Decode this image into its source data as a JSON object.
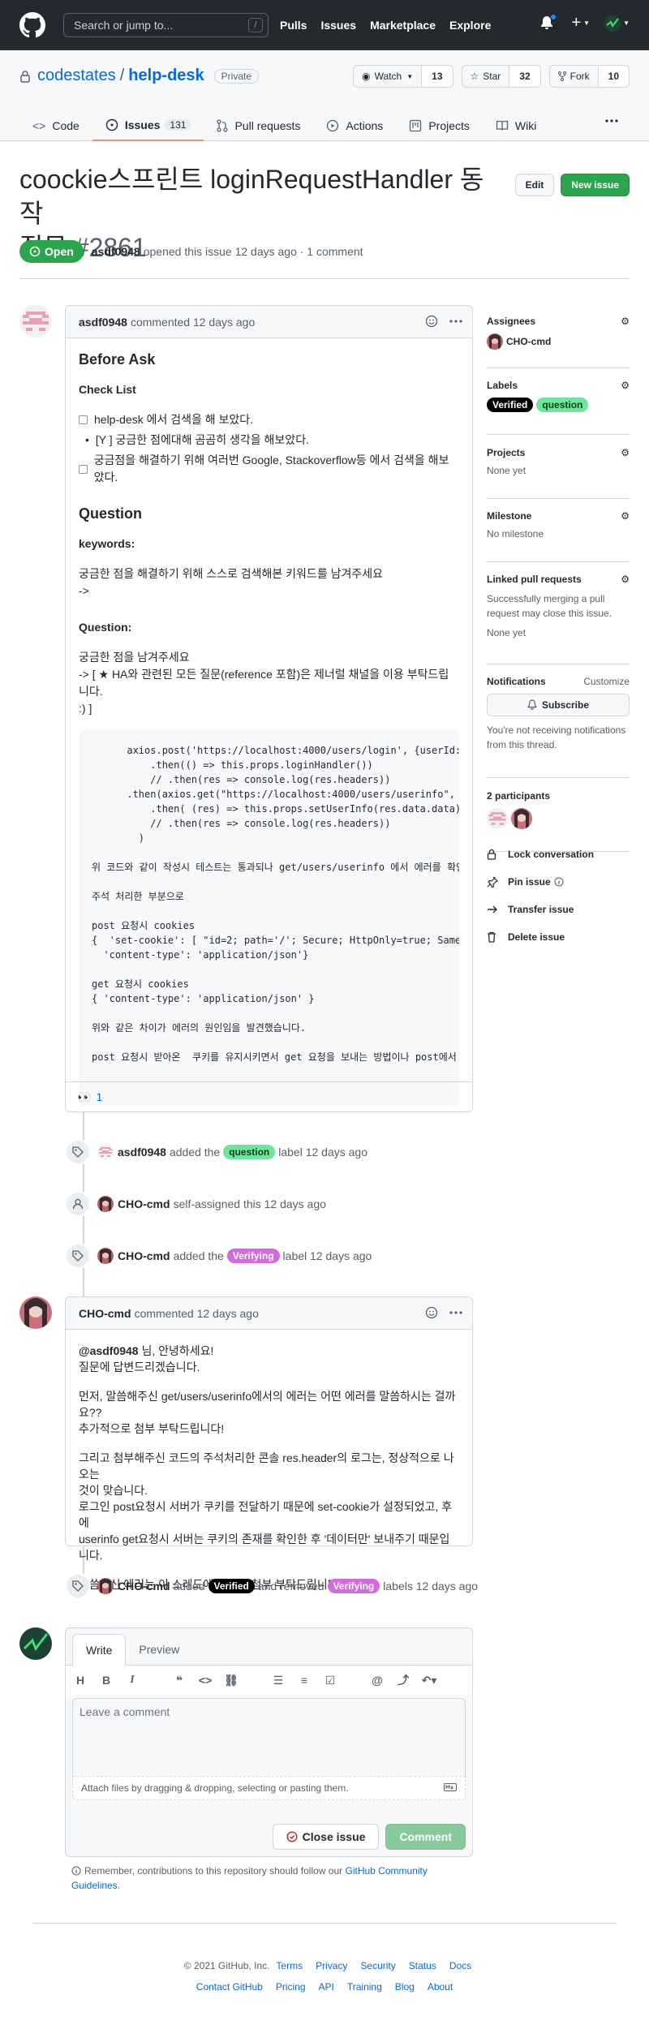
{
  "header": {
    "search_placeholder": "Search or jump to...",
    "search_shortcut": "/",
    "nav": [
      "Pulls",
      "Issues",
      "Marketplace",
      "Explore"
    ]
  },
  "repo": {
    "owner": "codestates",
    "separator": "/",
    "name": "help-desk",
    "visibility": "Private",
    "watch_label": "Watch",
    "watch_count": "13",
    "star_label": "Star",
    "star_count": "32",
    "fork_label": "Fork",
    "fork_count": "10",
    "tabs": [
      {
        "label": "Code",
        "icon": "code-icon"
      },
      {
        "label": "Issues",
        "icon": "issue-opened-icon",
        "count": "131"
      },
      {
        "label": "Pull requests",
        "icon": "git-pull-request-icon"
      },
      {
        "label": "Actions",
        "icon": "play-icon"
      },
      {
        "label": "Projects",
        "icon": "project-icon"
      },
      {
        "label": "Wiki",
        "icon": "book-icon"
      }
    ]
  },
  "issue": {
    "title_line1": "coockie스프린트 loginRequestHandler 동작",
    "title_line2": "질문",
    "number": "#2861",
    "edit_label": "Edit",
    "new_issue_label": "New issue",
    "state": "Open",
    "author": "asdf0948",
    "meta": "opened this issue 12 days ago · 1 comment"
  },
  "comment1": {
    "author": "asdf0948",
    "meta": "commented 12 days ago",
    "h_before_ask": "Before Ask",
    "h_checklist": "Check List",
    "checklist": [
      "help-desk 에서 검색을 해 보았다.",
      "[Y ] 궁금한 점에대해 곰곰히 생각을 해보았다.",
      "궁금점을 해결하기 위해 여러번 Google, Stackoverflow등 에서 검색을 해보았다."
    ],
    "h_question": "Question",
    "h_keywords": "keywords:",
    "keywords_text1": "궁금한 점을 해결하기 위해 스스로 검색해본 키워드를 남겨주세요",
    "keywords_text2": "->",
    "h_question2": "Question:",
    "q_text1": "궁금한 점을 남겨주세요",
    "q_text2": "-> [ ★ HA와 관련된 모든 질문(reference 포함)은 제너럴 채널을 이용 부탁드립니다.",
    "q_text3": ":) ]",
    "code": "      axios.post('https://localhost:4000/users/login', {userId: this.state.username, password: this.state.password})\n          .then(() => this.props.loginHandler())\n          // .then(res => console.log(res.headers))\n      .then(axios.get(\"https://localhost:4000/users/userinfo\", {withCredentials: true}))\n          .then( (res) => this.props.setUserInfo(res.data.data))\n          // .then(res => console.log(res.headers))\n        )\n\n위 코드와 같이 작성시 테스트는 통과되나 get/users/userinfo 에서 에러를 확인하였습니다.\n\n주석 처리한 부분으로\n\npost 요청시 cookies\n{  'set-cookie': [ \"id=2; path='/'; Secure; HttpOnly=true; SameSite=None\" ],\n  'content-type': 'application/json'}\n\nget 요청시 cookies\n{ 'content-type': 'application/json' }\n\n위와 같은 차이가 에러의 원인임을 발견했습니다.\n\npost 요청시 받아온  쿠키를 유지시키면서 get 요청을 보내는 방법이나 post에서 생성된 쿠키를 get에서 사용하는 방법이 궁금합니다.\n",
    "reaction_emoji": "👀",
    "reaction_count": "1"
  },
  "events": [
    {
      "actor": "asdf0948",
      "pre": "added the",
      "label": "question",
      "post": "label 12 days ago",
      "icon": "tag-icon"
    },
    {
      "actor": "CHO-cmd",
      "pre": "self-assigned this 12 days ago",
      "icon": "person-icon"
    },
    {
      "actor": "CHO-cmd",
      "pre": "added the",
      "label": "Verifying",
      "post": "label 12 days ago",
      "icon": "tag-icon"
    },
    {
      "actor": "CHO-cmd",
      "pre": "added",
      "label": "Verified",
      "mid": "and removed",
      "label2": "Verifying",
      "post": "labels 12 days ago",
      "icon": "tag-icon"
    }
  ],
  "comment2": {
    "author": "CHO-cmd",
    "meta": "commented 12 days ago",
    "mention": "@asdf0948",
    "greet": " 님, 안녕하세요!",
    "p1b": "질문에 답변드리겠습니다.",
    "p2a": "먼저, 말씀해주신 get/users/userinfo에서의 에러는 어떤 에러를 말씀하시는 걸까요??",
    "p2b": "추가적으로 첨부 부탁드립니다!",
    "p3a": "그리고 첨부해주신 코드의 주석처리한 콘솔 res.header의 로그는, 정상적으로 나오는",
    "p3b": "것이 맞습니다.",
    "p3c": "로그인 post요청시 서버가 쿠키를 전달하기 때문에 set-cookie가 설정되었고, 후에",
    "p3d": "userinfo get요청시 서버는 쿠키의 존재를 확인한 후 '데이터만' 보내주기 때문입니다.",
    "p4": "말씀하신 에러는 이 스레드에 이어서 첨부 부탁드립니다 😀"
  },
  "sidebar": {
    "assignees_title": "Assignees",
    "assignee": "CHO-cmd",
    "labels_title": "Labels",
    "labels": [
      {
        "name": "Verified",
        "bg": "#000000",
        "fg": "#ffffff"
      },
      {
        "name": "question",
        "bg": "#6ee59a",
        "fg": "#0b3d1a"
      }
    ],
    "projects_title": "Projects",
    "projects_value": "None yet",
    "milestone_title": "Milestone",
    "milestone_value": "No milestone",
    "linked_title": "Linked pull requests",
    "linked_text": "Successfully merging a pull request may close this issue.",
    "linked_value": "None yet",
    "notifications_title": "Notifications",
    "customize": "Customize",
    "subscribe": "Subscribe",
    "notif_text": "You're not receiving notifications from this thread.",
    "participants": "2 participants",
    "lock": "Lock conversation",
    "pin": "Pin issue",
    "transfer": "Transfer issue",
    "delete": "Delete issue"
  },
  "write": {
    "tab_write": "Write",
    "tab_preview": "Preview",
    "placeholder": "Leave a comment",
    "attach": "Attach files by dragging & dropping, selecting or pasting them.",
    "close_issue": "Close issue",
    "comment": "Comment",
    "remember_pre": "Remember, contributions to this repository should follow our ",
    "remember_link": "GitHub Community Guidelines",
    "remember_post": "."
  },
  "footer": {
    "copyright": "© 2021 GitHub, Inc.",
    "row1": [
      "Terms",
      "Privacy",
      "Security",
      "Status",
      "Docs"
    ],
    "row2": [
      "Contact GitHub",
      "Pricing",
      "API",
      "Training",
      "Blog",
      "About"
    ]
  },
  "colors": {
    "header_bg": "#24292f",
    "open_green": "#2da44e",
    "verifying_label": "#d36bdc",
    "question_label": "#6ee59a",
    "verified_label": "#000000",
    "link": "#0969da"
  }
}
